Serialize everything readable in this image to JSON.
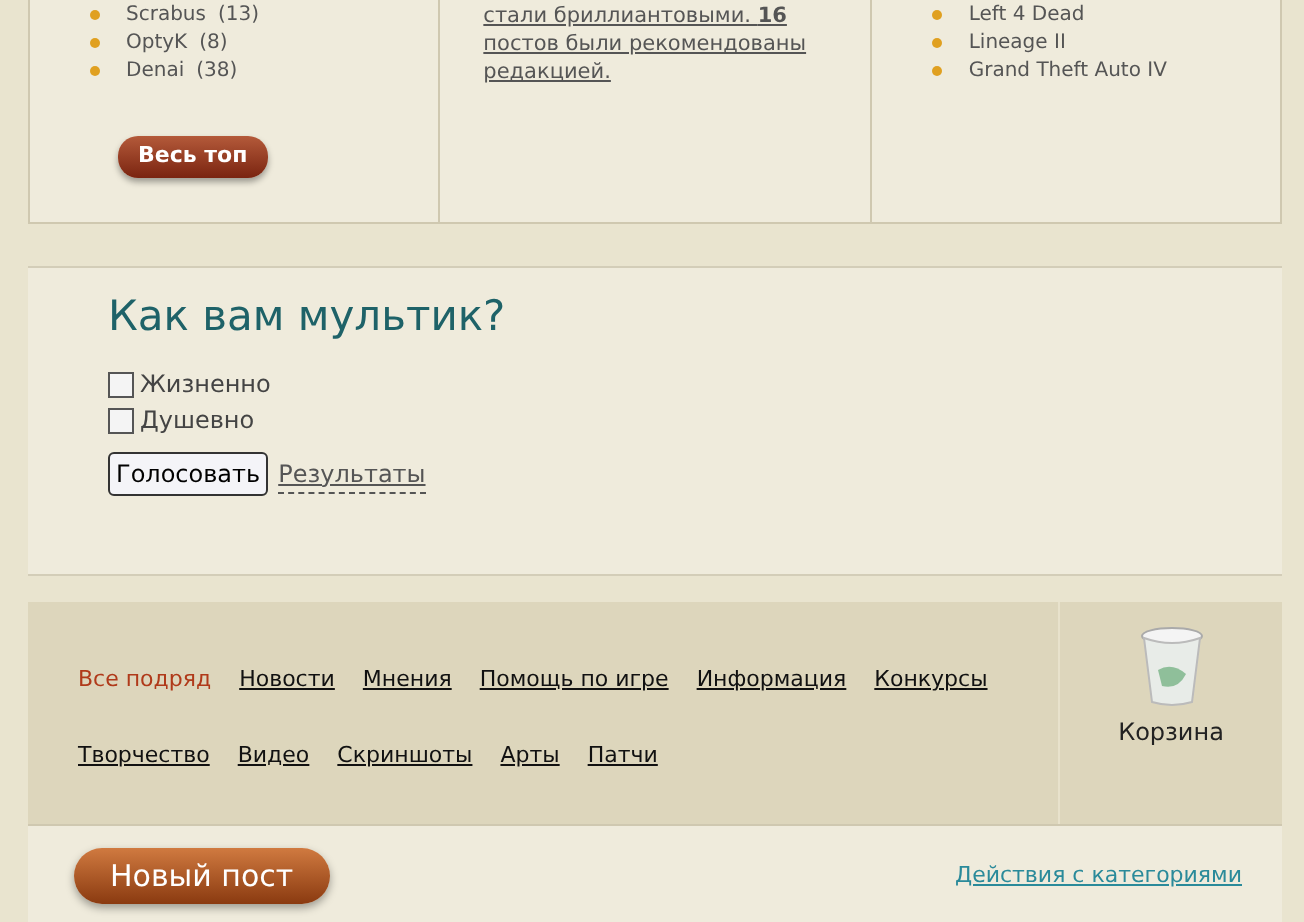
{
  "top_users": {
    "items": [
      {
        "name": "Scrabus",
        "count": "(13)"
      },
      {
        "name": "OptyK",
        "count": "(8)"
      },
      {
        "name": "Denai",
        "count": "(38)"
      }
    ],
    "button": "Весь топ"
  },
  "stats": {
    "text": "стали бриллиантовыми. **16** постов были рекомендованы редакцией."
  },
  "games": {
    "items": [
      "Left 4 Dead",
      "Lineage II",
      "Grand Theft Auto IV"
    ]
  },
  "poll": {
    "title": "Как вам мультик?",
    "options": [
      {
        "label": "Жизненно",
        "checked": false
      },
      {
        "label": "Душевно",
        "checked": false
      }
    ],
    "vote_button": "Голосовать",
    "results_link": "Результаты"
  },
  "categories": {
    "items": [
      {
        "label": "Все подряд",
        "selected": true
      },
      {
        "label": "Новости",
        "selected": false
      },
      {
        "label": "Мнения",
        "selected": false
      },
      {
        "label": "Помощь по игре",
        "selected": false
      },
      {
        "label": "Информация",
        "selected": false
      },
      {
        "label": "Конкурсы",
        "selected": false
      },
      {
        "label": "Творчество",
        "selected": false
      },
      {
        "label": "Видео",
        "selected": false
      },
      {
        "label": "Скриншоты",
        "selected": false
      },
      {
        "label": "Арты",
        "selected": false
      },
      {
        "label": "Патчи",
        "selected": false
      }
    ],
    "trash": "Корзина"
  },
  "footer": {
    "new_post": "Новый пост",
    "actions_link": "Действия с категориями"
  }
}
